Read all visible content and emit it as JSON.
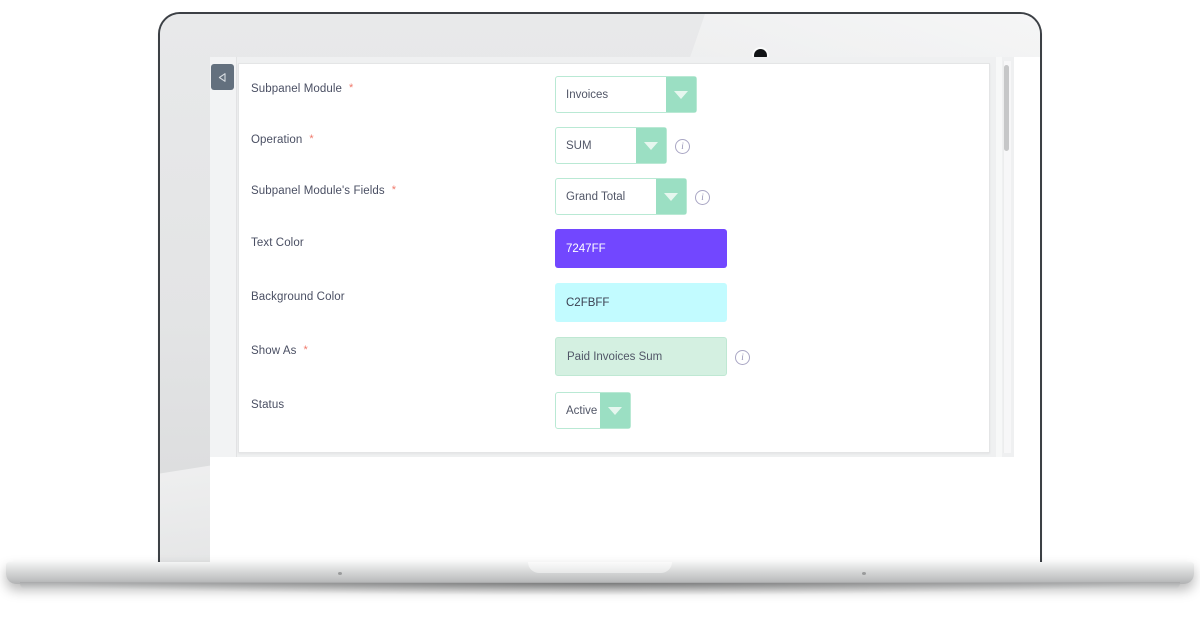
{
  "app": {
    "collapse_handle_icon": "caret-left-icon",
    "scrollbar_orientation": "vertical"
  },
  "form": {
    "fields": [
      {
        "label": "Subpanel Module",
        "required": true,
        "type": "select",
        "value": "Invoices",
        "has_info": false
      },
      {
        "label": "Operation",
        "required": true,
        "type": "select",
        "value": "SUM",
        "has_info": true
      },
      {
        "label": "Subpanel Module's Fields",
        "required": true,
        "type": "select",
        "value": "Grand Total",
        "has_info": true
      },
      {
        "label": "Text Color",
        "required": false,
        "type": "color",
        "value": "7247FF",
        "has_info": false
      },
      {
        "label": "Background Color",
        "required": false,
        "type": "color",
        "value": "C2FBFF",
        "has_info": false
      },
      {
        "label": "Show As",
        "required": true,
        "type": "text",
        "value": "Paid Invoices Sum",
        "has_info": true
      },
      {
        "label": "Status",
        "required": false,
        "type": "select",
        "value": "Active",
        "has_info": false
      }
    ],
    "required_marker": "*",
    "info_glyph": "i"
  },
  "colors": {
    "text_color_value": "#7247FF",
    "text_color_foreground": "#ffffff",
    "background_color_value": "#C2FBFF",
    "background_color_foreground": "#3c4152",
    "show_as_fill": "#d4f0e1",
    "accent_mint": "#9bdfc3",
    "field_border": "#b9e9d4",
    "required_asterisk": "#f0796b",
    "label_text": "#4a4f63"
  }
}
